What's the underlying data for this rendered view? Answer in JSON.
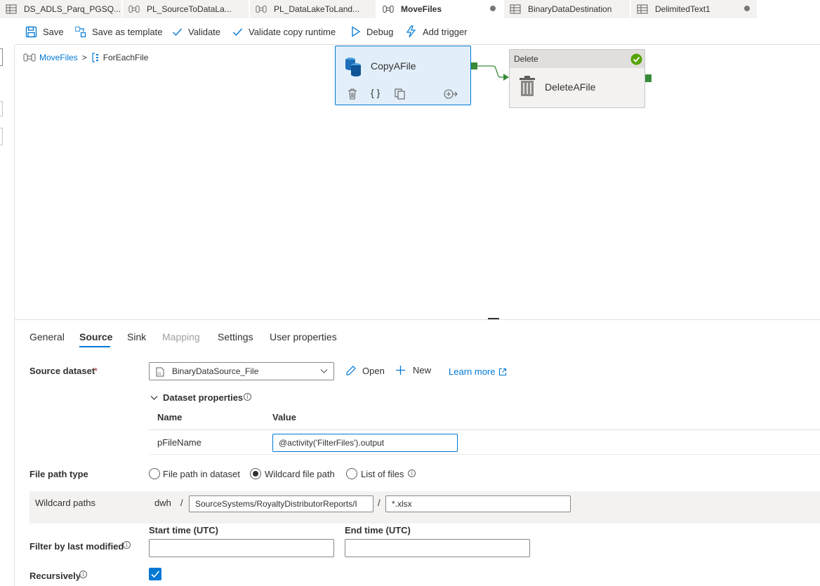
{
  "tabs": [
    {
      "label": "DS_ADLS_Parq_PGSQ...",
      "icon": "table-icon",
      "active": false,
      "unsaved": false
    },
    {
      "label": "PL_SourceToDataLa...",
      "icon": "pipeline-icon",
      "active": false,
      "unsaved": false
    },
    {
      "label": "PL_DataLakeToLand...",
      "icon": "pipeline-icon",
      "active": false,
      "unsaved": false
    },
    {
      "label": "MoveFiles",
      "icon": "pipeline-icon",
      "active": true,
      "unsaved": true
    },
    {
      "label": "BinaryDataDestination",
      "icon": "table-icon",
      "active": false,
      "unsaved": false
    },
    {
      "label": "DelimitedText1",
      "icon": "table-icon",
      "active": false,
      "unsaved": true
    }
  ],
  "toolbar": {
    "save": "Save",
    "save_template": "Save as template",
    "validate": "Validate",
    "validate_runtime": "Validate copy runtime",
    "debug": "Debug",
    "add_trigger": "Add trigger"
  },
  "breadcrumb": {
    "pipeline": "MoveFiles",
    "separator": ">",
    "activity": "ForEachFile"
  },
  "canvas": {
    "copy_activity": {
      "name": "CopyAFile"
    },
    "delete_activity": {
      "type_label": "Delete",
      "name": "DeleteAFile",
      "status": "succeeded"
    }
  },
  "props_tabs": [
    {
      "label": "General",
      "state": "normal"
    },
    {
      "label": "Source",
      "state": "active"
    },
    {
      "label": "Sink",
      "state": "normal"
    },
    {
      "label": "Mapping",
      "state": "disabled"
    },
    {
      "label": "Settings",
      "state": "normal"
    },
    {
      "label": "User properties",
      "state": "normal"
    }
  ],
  "source": {
    "dataset_label": "Source dataset",
    "required_mark": "*",
    "dataset_value": "BinaryDataSource_File",
    "open": "Open",
    "new": "New",
    "learn_more": "Learn more",
    "dataset_properties": "Dataset properties",
    "col_name": "Name",
    "col_value": "Value",
    "param_name": "pFileName",
    "param_value": "@activity('FilterFiles').output",
    "file_path_type_label": "File path type",
    "option_dataset": "File path in dataset",
    "option_wildcard": "Wildcard file path",
    "option_list": "List of files",
    "selected_option": "Wildcard file path",
    "wildcard_label": "Wildcard paths",
    "wildcard_container": "dwh",
    "slash": "/",
    "wildcard_folder": "SourceSystems/RoyaltyDistributorReports/I",
    "wildcard_file": "*.xlsx",
    "filter_label": "Filter by last modified",
    "start_time_label": "Start time (UTC)",
    "end_time_label": "End time (UTC)",
    "start_time_value": "",
    "end_time_value": "",
    "recursively_label": "Recursively",
    "recursively_checked": true
  },
  "colors": {
    "accent": "#0078d4",
    "activity_selected_bg": "#e2effa",
    "success": "#57a300",
    "connector": "#3a8a3a"
  }
}
